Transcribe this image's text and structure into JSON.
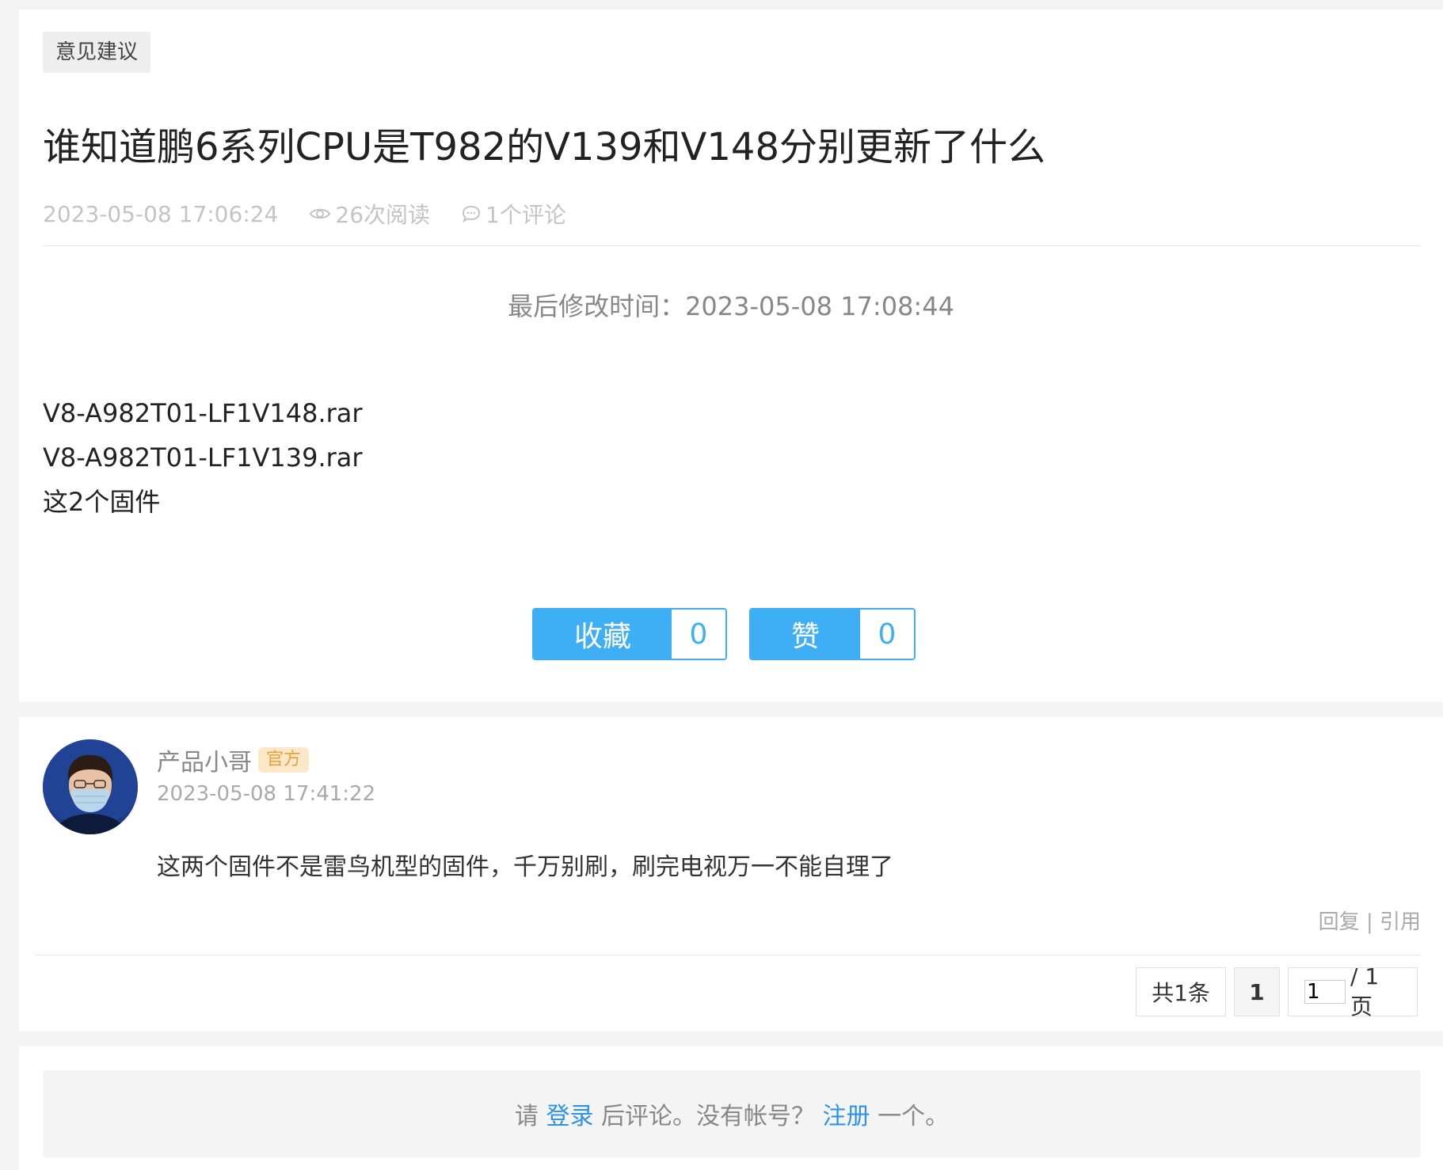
{
  "post": {
    "category": "意见建议",
    "title": "谁知道鹏6系列CPU是T982的V139和V148分别更新了什么",
    "date": "2023-05-08 17:06:24",
    "views": "26次阅读",
    "comments": "1个评论",
    "last_modified": "最后修改时间：2023-05-08 17:08:44",
    "body_lines": [
      "V8-A982T01-LF1V148.rar",
      "V8-A982T01-LF1V139.rar",
      "这2个固件"
    ],
    "favorite": {
      "label": "收藏",
      "count": "0"
    },
    "like": {
      "label": "赞",
      "count": "0"
    }
  },
  "comment": {
    "author": "产品小哥",
    "badge": "官方",
    "time": "2023-05-08 17:41:22",
    "text": "这两个固件不是雷鸟机型的固件，千万别刷，刷完电视万一不能自理了",
    "reply": "回复",
    "separator": "|",
    "quote": "引用"
  },
  "pagination": {
    "total": "共1条",
    "current": "1",
    "jump_value": "1",
    "page_suffix": "/ 1页"
  },
  "login_prompt": {
    "prefix": "请 ",
    "login": "登录",
    "middle": " 后评论。没有帐号？ ",
    "register": "注册",
    "suffix": " 一个。"
  },
  "colors": {
    "accent": "#3eaef5",
    "link": "#2d93e8",
    "badge_bg": "#fbe8c9",
    "badge_text": "#e8a23c"
  }
}
